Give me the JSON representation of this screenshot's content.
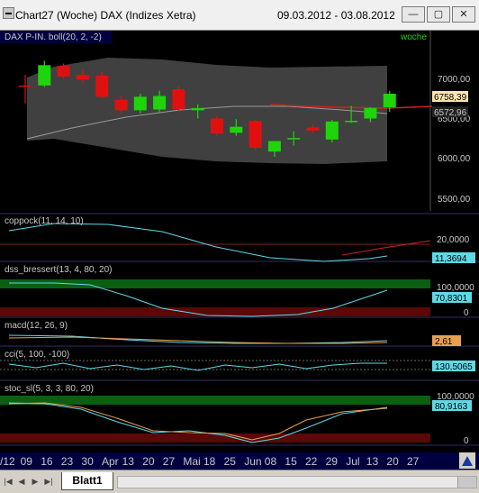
{
  "window": {
    "title": "Chart27 (Woche)  DAX (Indizes Xetra)",
    "date_range": "09.03.2012 - 03.08.2012",
    "buttons": [
      "—",
      "▢",
      "✕"
    ]
  },
  "colors": {
    "background": "#000000",
    "bollinger_band": "#404040",
    "bullish_candle": "#1ed40a",
    "bearish_candle": "#e01010",
    "moving_average": "#cc2222",
    "cyan_line": "#5fd9e6",
    "orange_line": "#e8a050",
    "axis_text": "#c8c8c8",
    "zone_green": "#0a6010",
    "zone_red": "#5a0808"
  },
  "main_panel": {
    "label": "DAX P-IN. boll(20, 2, -2)",
    "corner_label": "woche",
    "y_ticks": [
      "7000,00",
      "6500,00",
      "6000,00",
      "5500,00"
    ],
    "last_price": "6758,39",
    "ma_value": "6572,96"
  },
  "indicators": [
    {
      "label": "coppock(11, 14, 10)",
      "ticks": [
        "20,0000",
        "0"
      ],
      "value": "11,3694"
    },
    {
      "label": "dss_bressert(13, 4, 80, 20)",
      "ticks": [
        "100,0000",
        "0"
      ],
      "value": "70,8301"
    },
    {
      "label": "macd(12, 26, 9)",
      "ticks": [],
      "value": "2,61"
    },
    {
      "label": "cci(5, 100, -100)",
      "ticks": [],
      "value": "130,5065"
    },
    {
      "label": "stoc_sl(5, 3, 3, 80, 20)",
      "ticks": [
        "100,0000",
        "0"
      ],
      "value": "80,9163"
    }
  ],
  "x_axis": {
    "labels": [
      "/12",
      "09",
      "16",
      "23",
      "30",
      "Apr",
      "13",
      "20",
      "27",
      "Mai",
      "18",
      "25",
      "Jun",
      "08",
      "15",
      "22",
      "29",
      "Jul",
      "13",
      "20",
      "27"
    ]
  },
  "bottom": {
    "sheet_tab": "Blatt1",
    "nav": [
      "|◀",
      "◀",
      "▶",
      "▶|"
    ]
  },
  "chart_data": {
    "type": "candlestick",
    "title": "DAX P-IN. boll(20, 2, -2)",
    "candles": [
      {
        "o": 6870,
        "h": 7010,
        "l": 6630,
        "c": 6860
      },
      {
        "o": 6870,
        "h": 7200,
        "l": 6850,
        "c": 7140
      },
      {
        "o": 7130,
        "h": 7160,
        "l": 6960,
        "c": 6990
      },
      {
        "o": 7010,
        "h": 7080,
        "l": 6900,
        "c": 6950
      },
      {
        "o": 7000,
        "h": 7050,
        "l": 6700,
        "c": 6720
      },
      {
        "o": 6680,
        "h": 6730,
        "l": 6500,
        "c": 6540
      },
      {
        "o": 6540,
        "h": 6760,
        "l": 6500,
        "c": 6720
      },
      {
        "o": 6550,
        "h": 6800,
        "l": 6500,
        "c": 6730
      },
      {
        "o": 6820,
        "h": 6860,
        "l": 6510,
        "c": 6550
      },
      {
        "o": 6540,
        "h": 6620,
        "l": 6430,
        "c": 6570
      },
      {
        "o": 6430,
        "h": 6460,
        "l": 6200,
        "c": 6230
      },
      {
        "o": 6240,
        "h": 6420,
        "l": 6200,
        "c": 6320
      },
      {
        "o": 6400,
        "h": 6410,
        "l": 6010,
        "c": 6040
      },
      {
        "o": 5990,
        "h": 6130,
        "l": 5920,
        "c": 6130
      },
      {
        "o": 6170,
        "h": 6260,
        "l": 6070,
        "c": 6170
      },
      {
        "o": 6310,
        "h": 6350,
        "l": 6230,
        "c": 6270
      },
      {
        "o": 6150,
        "h": 6410,
        "l": 6110,
        "c": 6390
      },
      {
        "o": 6400,
        "h": 6600,
        "l": 6370,
        "c": 6400
      },
      {
        "o": 6430,
        "h": 6580,
        "l": 6380,
        "c": 6570
      },
      {
        "o": 6580,
        "h": 6800,
        "l": 6520,
        "c": 6760
      }
    ],
    "ylim": [
      5200,
      7600
    ],
    "y_ticks": [
      7000,
      6500,
      6000,
      5500
    ]
  }
}
